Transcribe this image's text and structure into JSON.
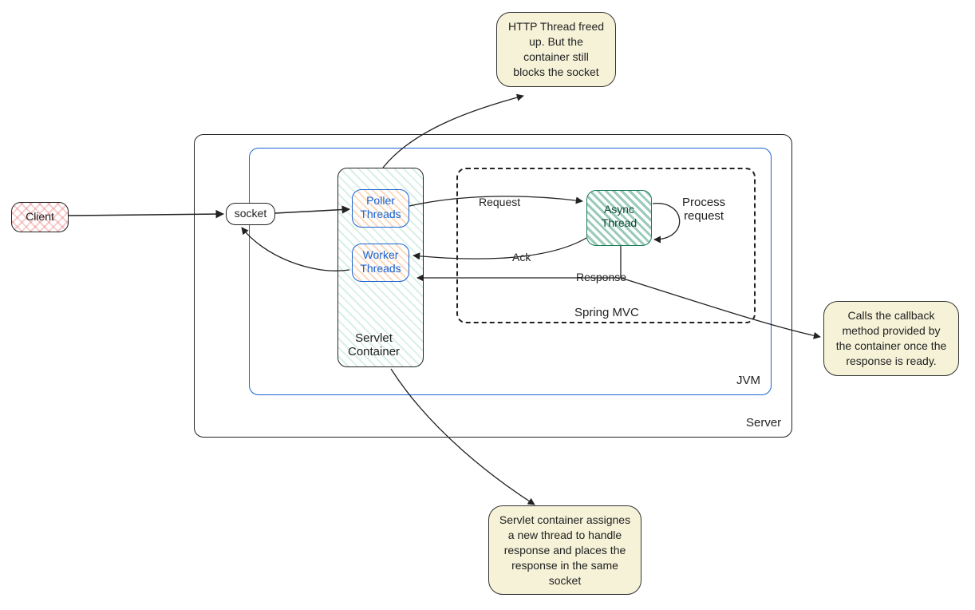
{
  "nodes": {
    "client": "Client",
    "socket": "socket",
    "server": "Server",
    "jvm": "JVM",
    "servlet_container": "Servlet\nContainer",
    "poller_threads": "Poller\nThreads",
    "worker_threads": "Worker\nThreads",
    "spring_mvc": "Spring MVC",
    "async_thread": "Async\nThread",
    "process_request": "Process\nrequest"
  },
  "edges": {
    "request": "Request",
    "ack": "Ack",
    "response": "Response"
  },
  "notes": {
    "http_freed": "HTTP Thread freed up. But the container still blocks the socket",
    "callback": "Calls the callback method provided by the container once the response is ready.",
    "assign_thread": "Servlet container assignes a new thread to handle response and places the response in the same socket"
  }
}
